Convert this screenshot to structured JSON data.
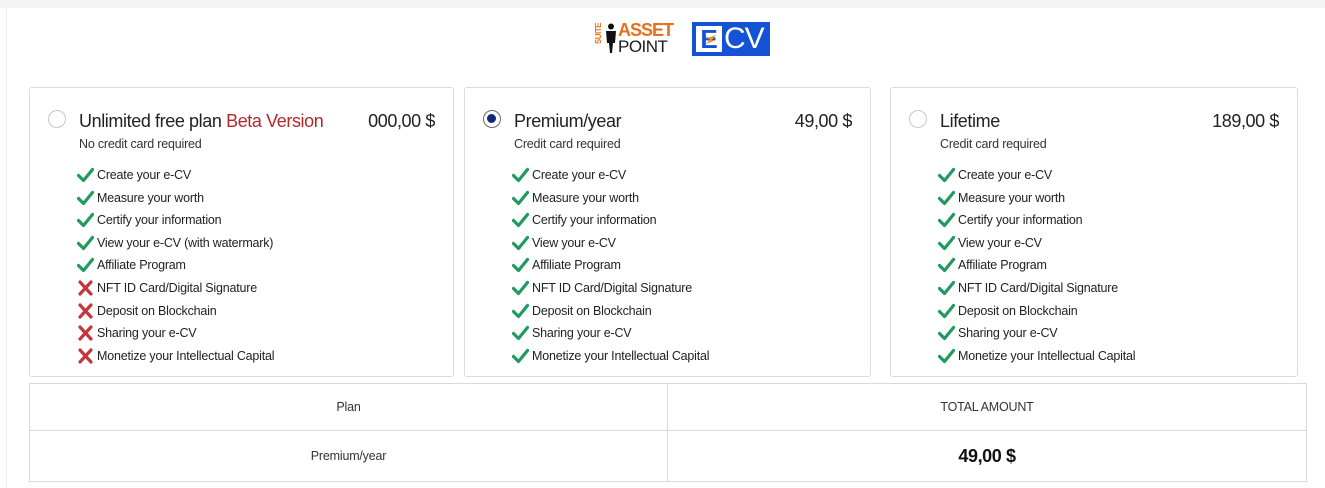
{
  "brand": {
    "assetpoint_suite": "SUITE",
    "assetpoint_top": "ASSET",
    "assetpoint_bottom": "POINT",
    "ecv_e": "E",
    "ecv_text": "CV"
  },
  "colors": {
    "check": "#1f9b5f",
    "cross": "#c4363d",
    "beta": "#b4272f",
    "radio_selected": "#14287a",
    "ecv_blue": "#1452d6",
    "assetpoint_orange": "#e8701a"
  },
  "plans": [
    {
      "name": "Unlimited free plan",
      "badge": "Beta Version",
      "price": "000,00 $",
      "subtitle": "No credit card required",
      "selected": false,
      "features": [
        {
          "label": "Create your e-CV",
          "included": true
        },
        {
          "label": "Measure your worth",
          "included": true
        },
        {
          "label": "Certify your information",
          "included": true
        },
        {
          "label": "View your e-CV (with watermark)",
          "included": true
        },
        {
          "label": "Affiliate Program",
          "included": true
        },
        {
          "label": "NFT ID Card/Digital Signature",
          "included": false
        },
        {
          "label": "Deposit on Blockchain",
          "included": false
        },
        {
          "label": "Sharing your e-CV",
          "included": false
        },
        {
          "label": "Monetize your Intellectual Capital",
          "included": false
        }
      ]
    },
    {
      "name": "Premium/year",
      "badge": "",
      "price": "49,00 $",
      "subtitle": "Credit card required",
      "selected": true,
      "features": [
        {
          "label": "Create your e-CV",
          "included": true
        },
        {
          "label": "Measure your worth",
          "included": true
        },
        {
          "label": "Certify your information",
          "included": true
        },
        {
          "label": "View your e-CV",
          "included": true
        },
        {
          "label": "Affiliate Program",
          "included": true
        },
        {
          "label": "NFT ID Card/Digital Signature",
          "included": true
        },
        {
          "label": "Deposit on Blockchain",
          "included": true
        },
        {
          "label": "Sharing your e-CV",
          "included": true
        },
        {
          "label": "Monetize your Intellectual Capital",
          "included": true
        }
      ]
    },
    {
      "name": "Lifetime",
      "badge": "",
      "price": "189,00 $",
      "subtitle": "Credit card required",
      "selected": false,
      "features": [
        {
          "label": "Create your e-CV",
          "included": true
        },
        {
          "label": "Measure your worth",
          "included": true
        },
        {
          "label": "Certify your information",
          "included": true
        },
        {
          "label": "View your e-CV",
          "included": true
        },
        {
          "label": "Affiliate Program",
          "included": true
        },
        {
          "label": "NFT ID Card/Digital Signature",
          "included": true
        },
        {
          "label": "Deposit on Blockchain",
          "included": true
        },
        {
          "label": "Sharing your e-CV",
          "included": true
        },
        {
          "label": "Monetize your Intellectual Capital",
          "included": true
        }
      ]
    }
  ],
  "summary": {
    "header_plan": "Plan",
    "header_total": "TOTAL AMOUNT",
    "selected_plan": "Premium/year",
    "total_amount": "49,00 $"
  }
}
